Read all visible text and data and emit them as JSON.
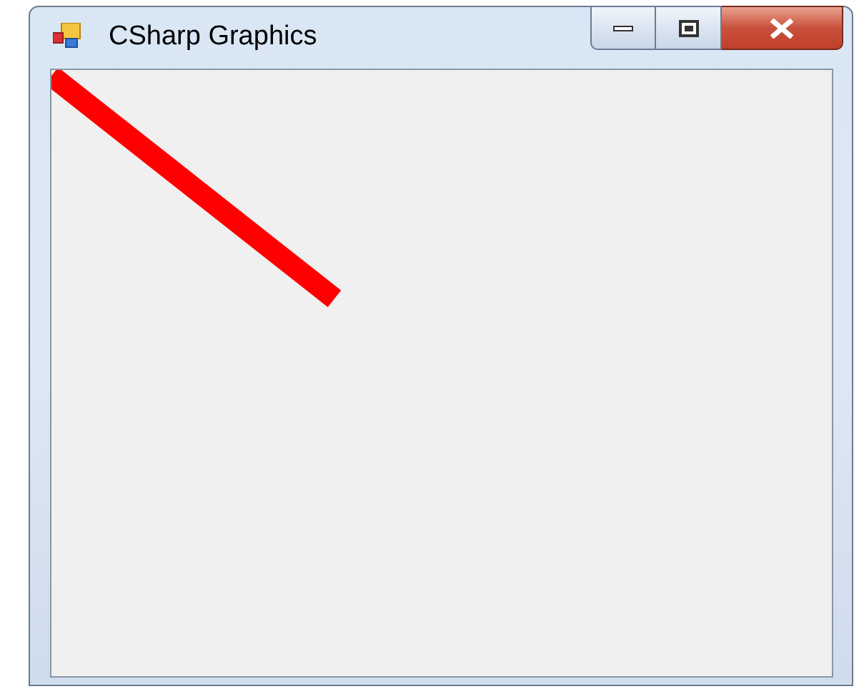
{
  "window": {
    "title": "CSharp Graphics"
  }
}
